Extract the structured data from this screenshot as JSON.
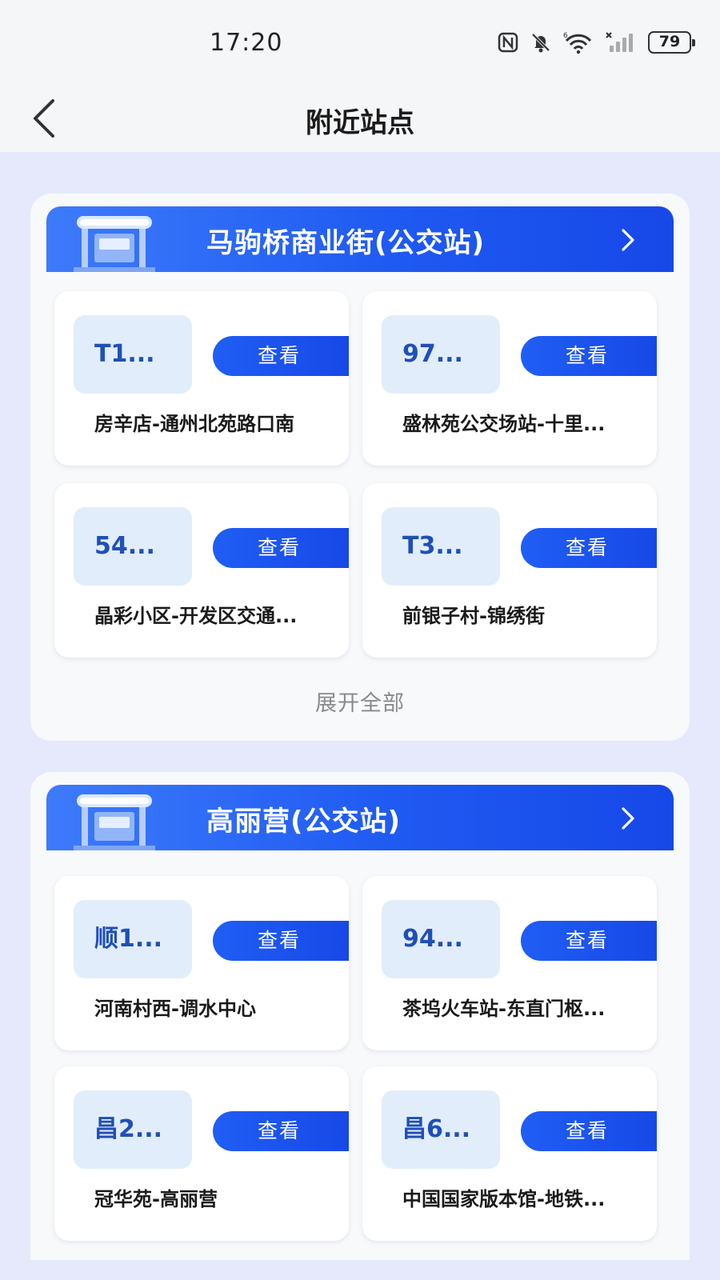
{
  "status_bar": {
    "time": "17:20",
    "battery": "79",
    "icons": [
      "nfc-icon",
      "mute-icon",
      "wifi-icon",
      "signal-icon",
      "battery-icon"
    ]
  },
  "nav": {
    "title": "附近站点",
    "back_icon": "chevron-left-icon"
  },
  "stations": [
    {
      "name": "马驹桥商业街(公交站)",
      "routes": [
        {
          "line": "T1...",
          "view": "查看",
          "desc": "房辛店-通州北苑路口南"
        },
        {
          "line": "97...",
          "view": "查看",
          "desc": "盛林苑公交场站-十里..."
        },
        {
          "line": "54...",
          "view": "查看",
          "desc": "晶彩小区-开发区交通..."
        },
        {
          "line": "T3...",
          "view": "查看",
          "desc": "前银子村-锦绣街"
        }
      ],
      "expand_label": "展开全部"
    },
    {
      "name": "高丽营(公交站)",
      "routes": [
        {
          "line": "顺1...",
          "view": "查看",
          "desc": "河南村西-调水中心"
        },
        {
          "line": "94...",
          "view": "查看",
          "desc": "茶坞火车站-东直门枢..."
        },
        {
          "line": "昌2...",
          "view": "查看",
          "desc": "冠华苑-高丽营"
        },
        {
          "line": "昌6...",
          "view": "查看",
          "desc": "中国国家版本馆-地铁..."
        }
      ]
    }
  ],
  "colors": {
    "page_bg": "#e6e9fb",
    "header_blue": "#1f5af2",
    "badge_bg": "#e2edfb",
    "badge_text": "#1f4fb8"
  }
}
